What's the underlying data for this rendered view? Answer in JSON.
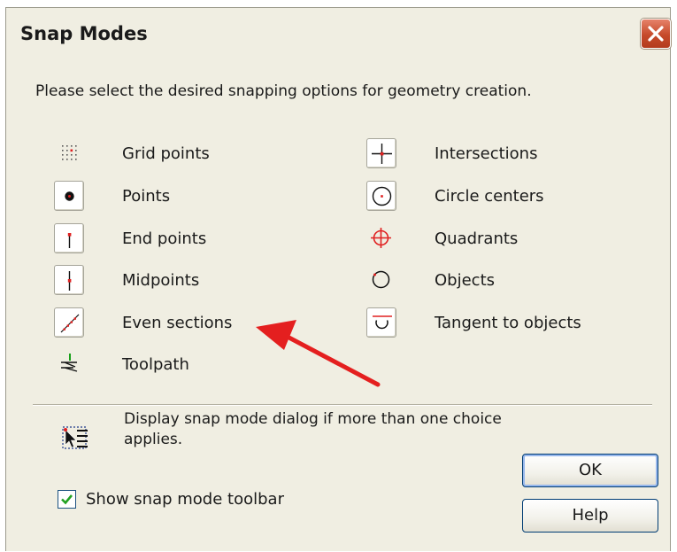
{
  "window": {
    "title": "Snap Modes",
    "close_label": "Close"
  },
  "prompt": "Please select the desired snapping options for geometry creation.",
  "options_left": [
    {
      "label": "Grid points",
      "icon": "grid-points-icon"
    },
    {
      "label": "Points",
      "icon": "point-icon"
    },
    {
      "label": "End points",
      "icon": "end-points-icon"
    },
    {
      "label": "Midpoints",
      "icon": "midpoints-icon"
    },
    {
      "label": "Even sections",
      "icon": "even-sections-icon"
    },
    {
      "label": "Toolpath",
      "icon": "toolpath-icon"
    }
  ],
  "options_right": [
    {
      "label": "Intersections",
      "icon": "intersections-icon"
    },
    {
      "label": "Circle centers",
      "icon": "circle-centers-icon"
    },
    {
      "label": "Quadrants",
      "icon": "quadrants-icon"
    },
    {
      "label": "Objects",
      "icon": "objects-icon"
    },
    {
      "label": "Tangent to objects",
      "icon": "tangent-icon"
    }
  ],
  "info_text": "Display snap mode dialog if more than one choice applies.",
  "show_toolbar": {
    "label": "Show snap mode toolbar",
    "checked": true
  },
  "buttons": {
    "ok": "OK",
    "help": "Help"
  },
  "colors": {
    "dialog_bg": "#f0eee2",
    "accent_red": "#e02020",
    "close_red": "#c64a2a",
    "checkbox_green": "#21a121"
  }
}
